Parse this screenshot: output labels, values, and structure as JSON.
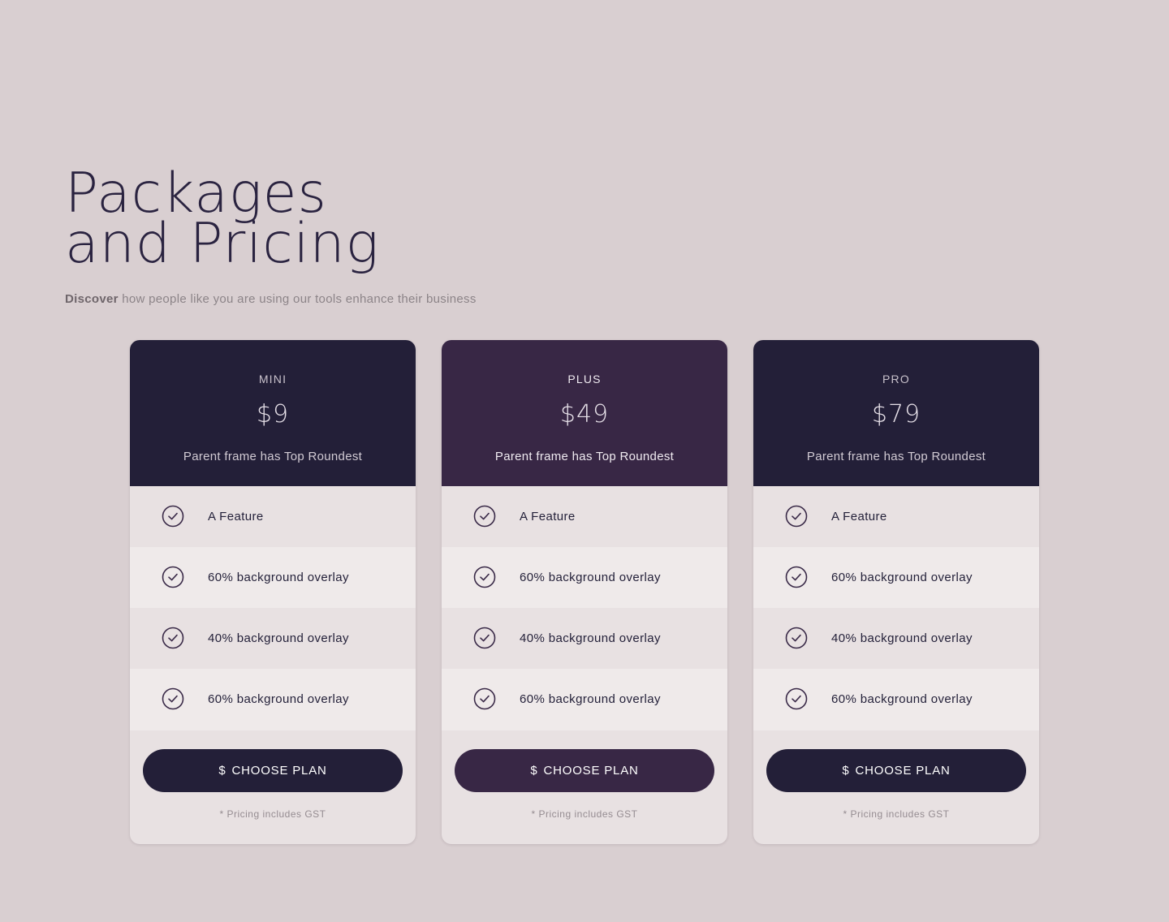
{
  "hero": {
    "title_line1": "Packages",
    "title_line2": "and Pricing",
    "subtitle_strong": "Discover",
    "subtitle_rest": " how people like you are using our tools enhance their business"
  },
  "plans": [
    {
      "name": "MINI",
      "price": "$9",
      "description": "Parent frame has Top Roundest",
      "header_color": "#231f38",
      "features": [
        {
          "label": "A Feature",
          "icon": "check-circle-icon"
        },
        {
          "label": "60% background overlay",
          "icon": "check-circle-icon"
        },
        {
          "label": "40% background overlay",
          "icon": "check-circle-icon"
        },
        {
          "label": "60% background overlay",
          "icon": "check-circle-icon"
        }
      ],
      "button_icon": "$",
      "button_label": "CHOOSE PLAN",
      "note": "* Pricing includes GST"
    },
    {
      "name": "PLUS",
      "price": "$49",
      "description": "Parent frame has Top Roundest",
      "header_color": "#382745",
      "features": [
        {
          "label": "A Feature",
          "icon": "check-circle-icon"
        },
        {
          "label": "60% background overlay",
          "icon": "check-circle-icon"
        },
        {
          "label": "40% background overlay",
          "icon": "check-circle-icon"
        },
        {
          "label": "60% background overlay",
          "icon": "check-circle-icon"
        }
      ],
      "button_icon": "$",
      "button_label": "CHOOSE PLAN",
      "note": "* Pricing includes GST"
    },
    {
      "name": "PRO",
      "price": "$79",
      "description": "Parent frame has Top Roundest",
      "header_color": "#231f38",
      "features": [
        {
          "label": "A Feature",
          "icon": "check-circle-icon"
        },
        {
          "label": "60% background overlay",
          "icon": "check-circle-icon"
        },
        {
          "label": "40% background overlay",
          "icon": "check-circle-icon"
        },
        {
          "label": "60% background overlay",
          "icon": "check-circle-icon"
        }
      ],
      "button_icon": "$",
      "button_label": "CHOOSE PLAN",
      "note": "* Pricing includes GST"
    }
  ],
  "colors": {
    "page_background": "#d9cfd1",
    "text_dark": "#221f38",
    "icon_stroke": "#3a2a48"
  }
}
